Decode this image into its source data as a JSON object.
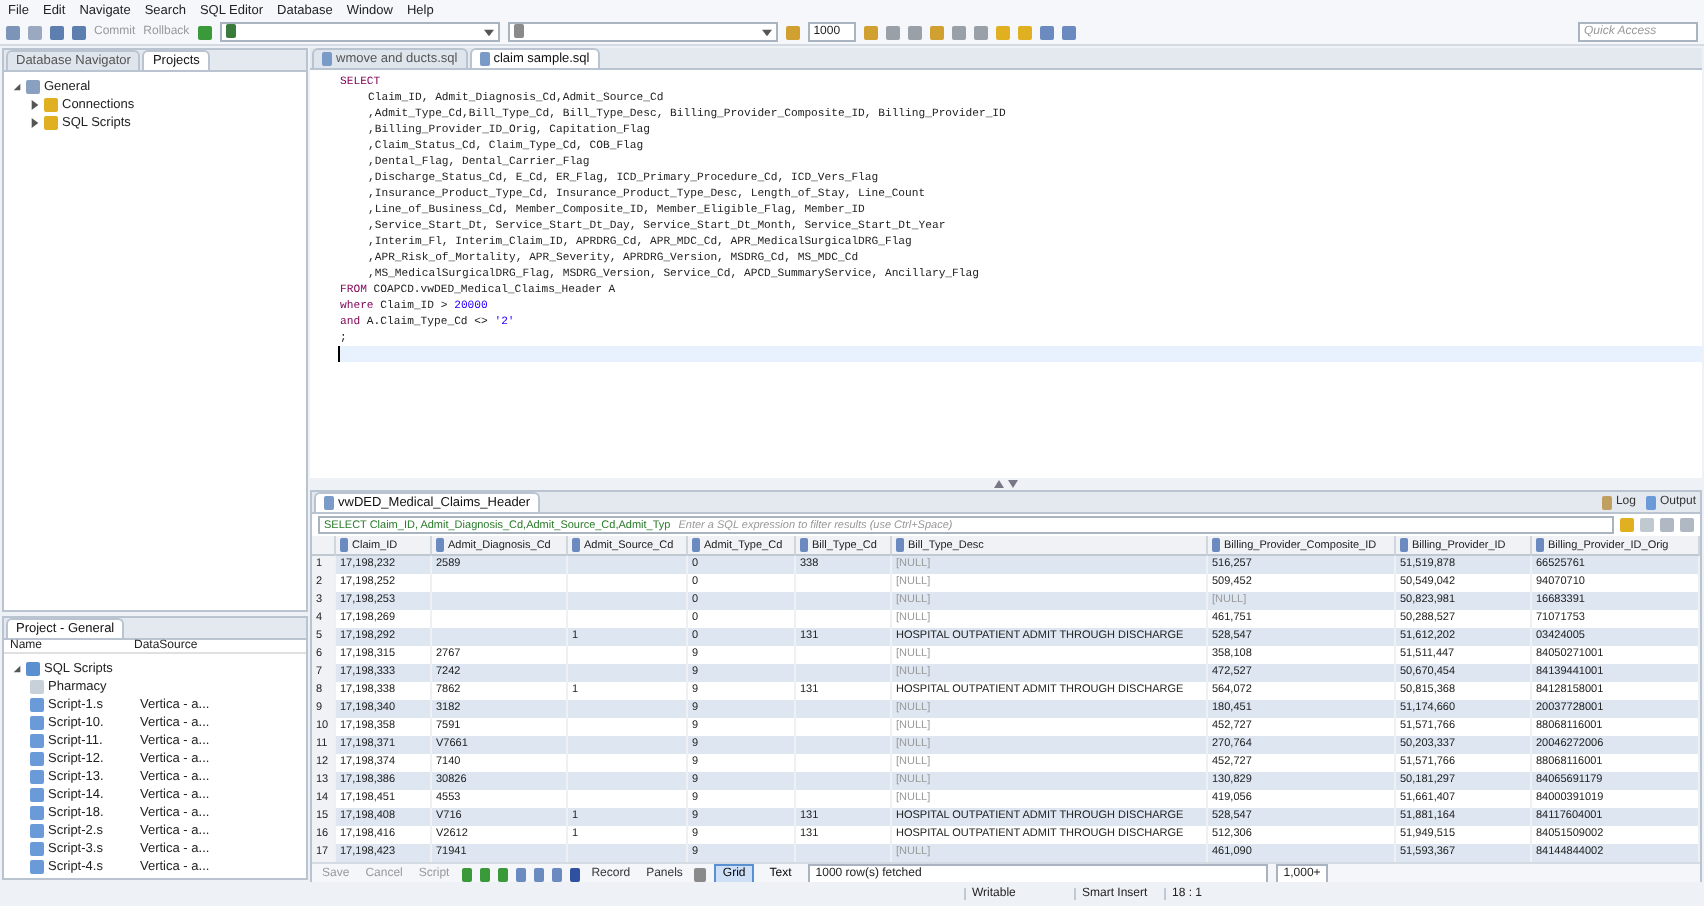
{
  "menu": [
    "File",
    "Edit",
    "Navigate",
    "Search",
    "SQL Editor",
    "Database",
    "Window",
    "Help"
  ],
  "toolbar": {
    "commit": "Commit",
    "rollback": "Rollback",
    "limit": "1000",
    "quick_access": "Quick Access"
  },
  "left_tabs": [
    {
      "label": "Database Navigator",
      "selected": false
    },
    {
      "label": "Projects",
      "selected": true
    }
  ],
  "project_tree": [
    {
      "label": "General",
      "expanded": true,
      "children": [
        {
          "label": "Connections",
          "expanded": false
        },
        {
          "label": "SQL Scripts",
          "expanded": false
        }
      ]
    }
  ],
  "project_panel": {
    "title": "Project - General",
    "columns": [
      "Name",
      "DataSource"
    ],
    "root": "SQL Scripts",
    "items": [
      {
        "name": "Pharmacy"
      },
      {
        "name": "Script-1.s",
        "source": "Vertica - a..."
      },
      {
        "name": "Script-10.",
        "source": "Vertica - a..."
      },
      {
        "name": "Script-11.",
        "source": "Vertica - a..."
      },
      {
        "name": "Script-12.",
        "source": "Vertica - a..."
      },
      {
        "name": "Script-13.",
        "source": "Vertica - a..."
      },
      {
        "name": "Script-14.",
        "source": "Vertica - a..."
      },
      {
        "name": "Script-18.",
        "source": "Vertica - a..."
      },
      {
        "name": "Script-2.s",
        "source": "Vertica - a..."
      },
      {
        "name": "Script-3.s",
        "source": "Vertica - a..."
      },
      {
        "name": "Script-4.s",
        "source": "Vertica - a..."
      }
    ]
  },
  "editor_tabs": [
    {
      "label": "wmove and ducts.sql",
      "selected": false
    },
    {
      "label": "claim sample.sql",
      "selected": true
    }
  ],
  "sql_lines": [
    {
      "current": false,
      "indented": false,
      "segments": [
        {
          "kind": "keyword",
          "text": "SELECT"
        }
      ]
    },
    {
      "current": false,
      "indented": true,
      "segments": [
        {
          "kind": "plain",
          "text": "Claim_ID, Admit_Diagnosis_Cd,Admit_Source_Cd"
        }
      ]
    },
    {
      "current": false,
      "indented": true,
      "segments": [
        {
          "kind": "plain",
          "text": ",Admit_Type_Cd,Bill_Type_Cd, Bill_Type_Desc, Billing_Provider_Composite_ID, Billing_Provider_ID"
        }
      ]
    },
    {
      "current": false,
      "indented": true,
      "segments": [
        {
          "kind": "plain",
          "text": ",Billing_Provider_ID_Orig, Capitation_Flag"
        }
      ]
    },
    {
      "current": false,
      "indented": true,
      "segments": [
        {
          "kind": "plain",
          "text": ",Claim_Status_Cd, Claim_Type_Cd, COB_Flag"
        }
      ]
    },
    {
      "current": false,
      "indented": true,
      "segments": [
        {
          "kind": "plain",
          "text": ",Dental_Flag, Dental_Carrier_Flag"
        }
      ]
    },
    {
      "current": false,
      "indented": true,
      "segments": [
        {
          "kind": "plain",
          "text": ",Discharge_Status_Cd, E_Cd, ER_Flag, ICD_Primary_Procedure_Cd, ICD_Vers_Flag"
        }
      ]
    },
    {
      "current": false,
      "indented": true,
      "segments": [
        {
          "kind": "plain",
          "text": ",Insurance_Product_Type_Cd, Insurance_Product_Type_Desc, Length_of_Stay, Line_Count"
        }
      ]
    },
    {
      "current": false,
      "indented": true,
      "segments": [
        {
          "kind": "plain",
          "text": ",Line_of_Business_Cd, Member_Composite_ID, Member_Eligible_Flag, Member_ID"
        }
      ]
    },
    {
      "current": false,
      "indented": true,
      "segments": [
        {
          "kind": "plain",
          "text": ",Service_Start_Dt, Service_Start_Dt_Day, Service_Start_Dt_Month, Service_Start_Dt_Year"
        }
      ]
    },
    {
      "current": false,
      "indented": true,
      "segments": [
        {
          "kind": "plain",
          "text": ",Interim_Fl, Interim_Claim_ID, APRDRG_Cd, APR_MDC_Cd, APR_MedicalSurgicalDRG_Flag"
        }
      ]
    },
    {
      "current": false,
      "indented": true,
      "segments": [
        {
          "kind": "plain",
          "text": ",APR_Risk_of_Mortality, APR_Severity, APRDRG_Version, MSDRG_Cd, MS_MDC_Cd"
        }
      ]
    },
    {
      "current": false,
      "indented": true,
      "segments": [
        {
          "kind": "plain",
          "text": ",MS_MedicalSurgicalDRG_Flag, MSDRG_Version, Service_Cd, APCD_SummaryService, Ancillary_Flag"
        }
      ]
    },
    {
      "current": false,
      "indented": false,
      "segments": [
        {
          "kind": "keyword",
          "text": "FROM"
        },
        {
          "kind": "plain",
          "text": " COAPCD.vwDED_Medical_Claims_Header A"
        }
      ]
    },
    {
      "current": false,
      "indented": false,
      "segments": [
        {
          "kind": "keyword",
          "text": "where"
        },
        {
          "kind": "plain",
          "text": " Claim_ID > "
        },
        {
          "kind": "number",
          "text": "20000"
        }
      ]
    },
    {
      "current": false,
      "indented": false,
      "segments": [
        {
          "kind": "keyword",
          "text": "and"
        },
        {
          "kind": "plain",
          "text": " A.Claim_Type_Cd <> "
        },
        {
          "kind": "string",
          "text": "'2'"
        }
      ]
    },
    {
      "current": false,
      "indented": false,
      "segments": [
        {
          "kind": "plain",
          "text": ";"
        }
      ]
    },
    {
      "current": true,
      "indented": false
    }
  ],
  "results": {
    "tab": "vwDED_Medical_Claims_Header",
    "log": "Log",
    "output": "Output",
    "filter_query": "SELECT Claim_ID, Admit_Diagnosis_Cd,Admit_Source_Cd,Admit_Typ",
    "filter_placeholder": "Enter a SQL expression to filter results (use Ctrl+Space)",
    "columns": [
      "Claim_ID",
      "Admit_Diagnosis_Cd",
      "Admit_Source_Cd",
      "Admit_Type_Cd",
      "Bill_Type_Cd",
      "Bill_Type_Desc",
      "Billing_Provider_Composite_ID",
      "Billing_Provider_ID",
      "Billing_Provider_ID_Orig"
    ],
    "rows": [
      {
        "num": "1",
        "cells": [
          "17,198,232",
          "2589",
          "",
          "0",
          "338",
          {
            "kind": "null",
            "text": "[NULL]"
          },
          "516,257",
          "51,519,878",
          "66525761"
        ]
      },
      {
        "num": "2",
        "cells": [
          "17,198,252",
          "",
          "",
          "0",
          "",
          {
            "kind": "null",
            "text": "[NULL]"
          },
          "509,452",
          "50,549,042",
          "94070710"
        ]
      },
      {
        "num": "3",
        "cells": [
          "17,198,253",
          "",
          "",
          "0",
          "",
          {
            "kind": "null",
            "text": "[NULL]"
          },
          {
            "kind": "null",
            "text": "[NULL]"
          },
          "50,823,981",
          "16683391"
        ]
      },
      {
        "num": "4",
        "cells": [
          "17,198,269",
          "",
          "",
          "0",
          "",
          {
            "kind": "null",
            "text": "[NULL]"
          },
          "461,751",
          "50,288,527",
          "71071753"
        ]
      },
      {
        "num": "5",
        "cells": [
          "17,198,292",
          "",
          "1",
          "0",
          "131",
          "HOSPITAL OUTPATIENT ADMIT THROUGH DISCHARGE",
          "528,547",
          "51,612,202",
          "03424005"
        ]
      },
      {
        "num": "6",
        "cells": [
          "17,198,315",
          "2767",
          "",
          "9",
          "",
          {
            "kind": "null",
            "text": "[NULL]"
          },
          "358,108",
          "51,511,447",
          "84050271001"
        ]
      },
      {
        "num": "7",
        "cells": [
          "17,198,333",
          "7242",
          "",
          "9",
          "",
          {
            "kind": "null",
            "text": "[NULL]"
          },
          "472,527",
          "50,670,454",
          "84139441001"
        ]
      },
      {
        "num": "8",
        "cells": [
          "17,198,338",
          "7862",
          "1",
          "9",
          "131",
          "HOSPITAL OUTPATIENT ADMIT THROUGH DISCHARGE",
          "564,072",
          "50,815,368",
          "84128158001"
        ]
      },
      {
        "num": "9",
        "cells": [
          "17,198,340",
          "3182",
          "",
          "9",
          "",
          {
            "kind": "null",
            "text": "[NULL]"
          },
          "180,451",
          "51,174,660",
          "20037728001"
        ]
      },
      {
        "num": "10",
        "cells": [
          "17,198,358",
          "7591",
          "",
          "9",
          "",
          {
            "kind": "null",
            "text": "[NULL]"
          },
          "452,727",
          "51,571,766",
          "88068116001"
        ]
      },
      {
        "num": "11",
        "cells": [
          "17,198,371",
          "V7661",
          "",
          "9",
          "",
          {
            "kind": "null",
            "text": "[NULL]"
          },
          "270,764",
          "50,203,337",
          "20046272006"
        ]
      },
      {
        "num": "12",
        "cells": [
          "17,198,374",
          "7140",
          "",
          "9",
          "",
          {
            "kind": "null",
            "text": "[NULL]"
          },
          "452,727",
          "51,571,766",
          "88068116001"
        ]
      },
      {
        "num": "13",
        "cells": [
          "17,198,386",
          "30826",
          "",
          "9",
          "",
          {
            "kind": "null",
            "text": "[NULL]"
          },
          "130,829",
          "50,181,297",
          "84065691179"
        ]
      },
      {
        "num": "14",
        "cells": [
          "17,198,451",
          "4553",
          "",
          "9",
          "",
          {
            "kind": "null",
            "text": "[NULL]"
          },
          "419,056",
          "51,661,407",
          "84000391019"
        ]
      },
      {
        "num": "15",
        "cells": [
          "17,198,408",
          "V716",
          "1",
          "9",
          "131",
          "HOSPITAL OUTPATIENT ADMIT THROUGH DISCHARGE",
          "528,547",
          "51,881,164",
          "84117604001"
        ]
      },
      {
        "num": "16",
        "cells": [
          "17,198,416",
          "V2612",
          "1",
          "9",
          "131",
          "HOSPITAL OUTPATIENT ADMIT THROUGH DISCHARGE",
          "512,306",
          "51,949,515",
          "84051509002"
        ]
      },
      {
        "num": "17",
        "cells": [
          "17,198,423",
          "71941",
          "",
          "9",
          "",
          {
            "kind": "null",
            "text": "[NULL]"
          },
          "461,090",
          "51,593,367",
          "84144844002"
        ]
      }
    ]
  },
  "result_toolbar": {
    "save": "Save",
    "cancel": "Cancel",
    "script": "Script",
    "record": "Record",
    "panels": "Panels",
    "views": [
      {
        "label": "Grid",
        "selected": true
      },
      {
        "label": "Text",
        "selected": false
      }
    ],
    "status": "1000 row(s) fetched",
    "count": "1,000+"
  },
  "status_bar": [
    "Writable",
    "Smart Insert",
    "18 : 1"
  ]
}
